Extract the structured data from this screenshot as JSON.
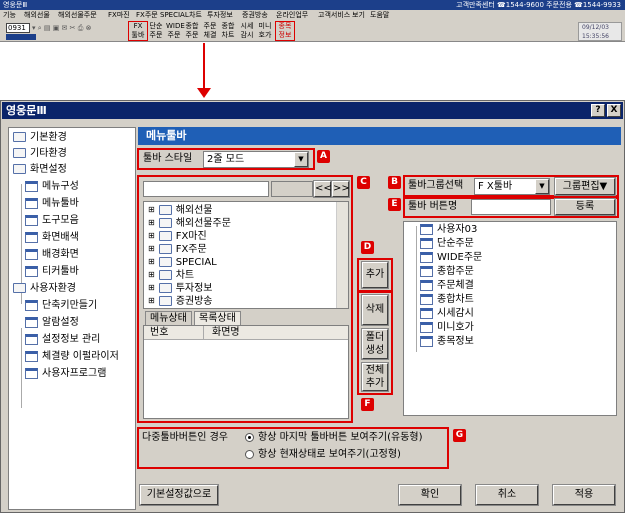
{
  "top_window": {
    "title": "영웅문Ⅲ",
    "title_right": "고객만족센터 ☎1544-9600 주문전용 ☎1544-9933",
    "menu": [
      "기능",
      "해외선물",
      "해외선물주문",
      "FX마진",
      "FX주문",
      "SPECIAL",
      "차트",
      "투자정보",
      "증권방송",
      "온라인업무",
      "고객서비스",
      "보기",
      "도움말"
    ],
    "code": "0931",
    "toolbar_row1": [
      "FX",
      "단순",
      "WIDE",
      "종합",
      "주문",
      "종합",
      "시세",
      "미니",
      "종목"
    ],
    "toolbar_row2": [
      "툴바",
      "주문",
      "주문",
      "주문",
      "체결",
      "차트",
      "감시",
      "호가",
      "정보"
    ],
    "clock_date": "09/12/03",
    "clock_time": "15:35:56"
  },
  "window": {
    "title": "영웅문Ⅲ",
    "help_button": "?",
    "close_button": "X"
  },
  "tree": {
    "items": [
      {
        "label": "기본환경",
        "type": "folder",
        "level": 0
      },
      {
        "label": "기타환경",
        "type": "folder",
        "level": 0
      },
      {
        "label": "화면설정",
        "type": "folder",
        "level": 0
      },
      {
        "label": "메뉴구성",
        "type": "window",
        "level": 1
      },
      {
        "label": "메뉴툴바",
        "type": "window",
        "level": 1
      },
      {
        "label": "도구모음",
        "type": "window",
        "level": 1
      },
      {
        "label": "화면배색",
        "type": "window",
        "level": 1
      },
      {
        "label": "배경화면",
        "type": "window",
        "level": 1
      },
      {
        "label": "티커툴바",
        "type": "window",
        "level": 1
      },
      {
        "label": "사용자환경",
        "type": "folder",
        "level": 0
      },
      {
        "label": "단축키만들기",
        "type": "window",
        "level": 1
      },
      {
        "label": "알람설정",
        "type": "window",
        "level": 1
      },
      {
        "label": "설정정보 관리",
        "type": "window",
        "level": 1
      },
      {
        "label": "체결량 이펄라이저",
        "type": "window",
        "level": 1
      },
      {
        "label": "사용자프로그램",
        "type": "window",
        "level": 1
      }
    ]
  },
  "panel": {
    "header": "메뉴툴바",
    "style_label": "툴바 스타일",
    "style_value": "2줄 모드",
    "nav_prev": "<<",
    "nav_next": ">>",
    "menu_tree": [
      {
        "label": "해외선물",
        "open": true
      },
      {
        "label": "해외선물주문"
      },
      {
        "label": "FX마진"
      },
      {
        "label": "FX주문"
      },
      {
        "label": "SPECIAL"
      },
      {
        "label": "차트"
      },
      {
        "label": "투자정보"
      },
      {
        "label": "증권방송"
      }
    ],
    "tab_menu": "메뉴상태",
    "tab_list": "목록상태",
    "col_no": "번호",
    "col_screen": "화면명",
    "btn_add": "추가",
    "btn_delete": "삭제",
    "btn_folder": "폴더\n생성",
    "btn_add_all": "전체\n추가",
    "group_label": "툴바그룹선택",
    "group_value": "F X툴바",
    "group_edit": "그룹편집▼",
    "button_name_label": "툴바 버튼명",
    "button_name_value": "",
    "register": "등록",
    "toolbar_items": [
      "사용자03",
      "단순주문",
      "WIDE주문",
      "종합주문",
      "주문체결",
      "종합차트",
      "시세감시",
      "미니호가",
      "종목정보"
    ],
    "multi_label": "다중툴바버튼인 경우",
    "radio1": "항상 마지막 툴바버튼 보여주기(유동형)",
    "radio2": "항상 현재상태로 보여주기(고정형)",
    "btn_default": "기본설정값으로",
    "btn_ok": "확인",
    "btn_cancel": "취소",
    "btn_apply": "적용"
  },
  "badges": [
    "A",
    "B",
    "C",
    "D",
    "E",
    "F",
    "G"
  ],
  "colors": {
    "accent": "#dd0000",
    "header": "#1f5fb6",
    "titlebar": "#0a246a"
  }
}
